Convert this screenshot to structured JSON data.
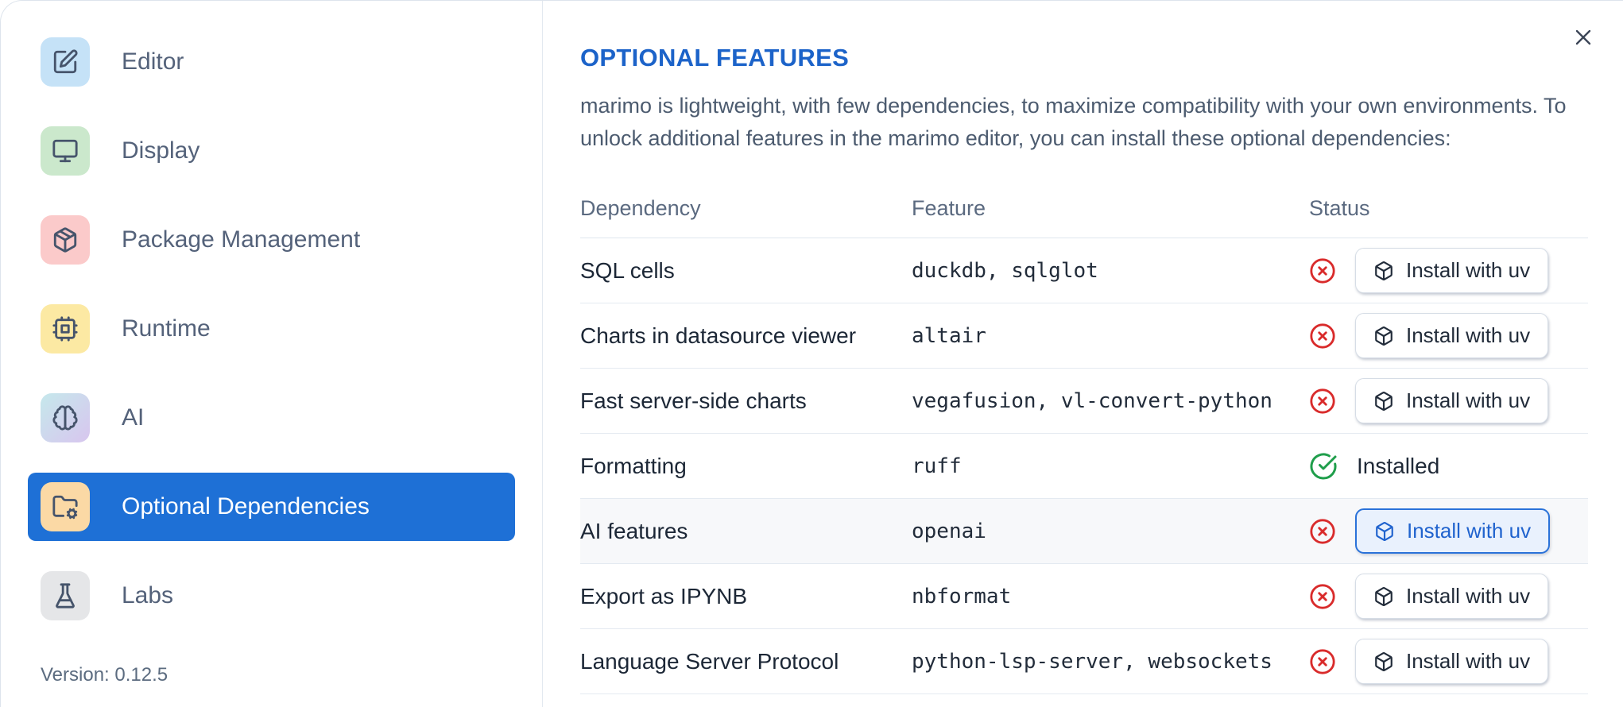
{
  "sidebar": {
    "items": [
      {
        "label": "Editor",
        "icon": "square-pen-icon",
        "tile_color": "#c5e2f7",
        "selected": false
      },
      {
        "label": "Display",
        "icon": "monitor-icon",
        "tile_color": "#cbe8cc",
        "selected": false
      },
      {
        "label": "Package Management",
        "icon": "package-icon",
        "tile_color": "#fbcaca",
        "selected": false
      },
      {
        "label": "Runtime",
        "icon": "cpu-icon",
        "tile_color": "#fce9a3",
        "selected": false
      },
      {
        "label": "AI",
        "icon": "brain-icon",
        "tile_color": "linear-gradient(135deg, #c7e5ec 10%, #d6c9ee 90%)",
        "selected": false
      },
      {
        "label": "Optional Dependencies",
        "icon": "folder-cog-icon",
        "tile_color": "#fbd9a5",
        "selected": true
      },
      {
        "label": "Labs",
        "icon": "flask-icon",
        "tile_color": "#e5e6e8",
        "selected": false
      }
    ],
    "selected_bg": "#1e70d6",
    "version": "Version: 0.12.5"
  },
  "panel": {
    "title": "OPTIONAL FEATURES",
    "description": "marimo is lightweight, with few dependencies, to maximize compatibility with your own environments. To unlock additional features in the marimo editor, you can install these optional dependencies:",
    "close_icon": "x-icon",
    "table": {
      "columns": [
        "Dependency",
        "Feature",
        "Status"
      ],
      "rows": [
        {
          "dependency": "SQL cells",
          "feature": "duckdb, sqlglot",
          "status": "not installed",
          "action": "Install with uv"
        },
        {
          "dependency": "Charts in datasource viewer",
          "feature": "altair",
          "status": "not installed",
          "action": "Install with uv"
        },
        {
          "dependency": "Fast server-side charts",
          "feature": "vegafusion, vl-convert-python",
          "status": "not installed",
          "action": "Install with uv"
        },
        {
          "dependency": "Formatting",
          "feature": "ruff",
          "status": "installed",
          "status_label": "Installed"
        },
        {
          "dependency": "AI features",
          "feature": "openai",
          "status": "not installed",
          "action": "Install with uv",
          "highlighted": true
        },
        {
          "dependency": "Export as IPYNB",
          "feature": "nbformat",
          "status": "not installed",
          "action": "Install with uv"
        },
        {
          "dependency": "Language Server Protocol",
          "feature": "python-lsp-server, websockets",
          "status": "not installed",
          "action": "Install with uv"
        }
      ]
    }
  },
  "colors": {
    "accent_blue": "#1e70d6",
    "title_blue": "#1c63c9",
    "error_red": "#d92b2b",
    "success_green": "#1f9e4b",
    "row_highlight": "#f7f8fa"
  }
}
